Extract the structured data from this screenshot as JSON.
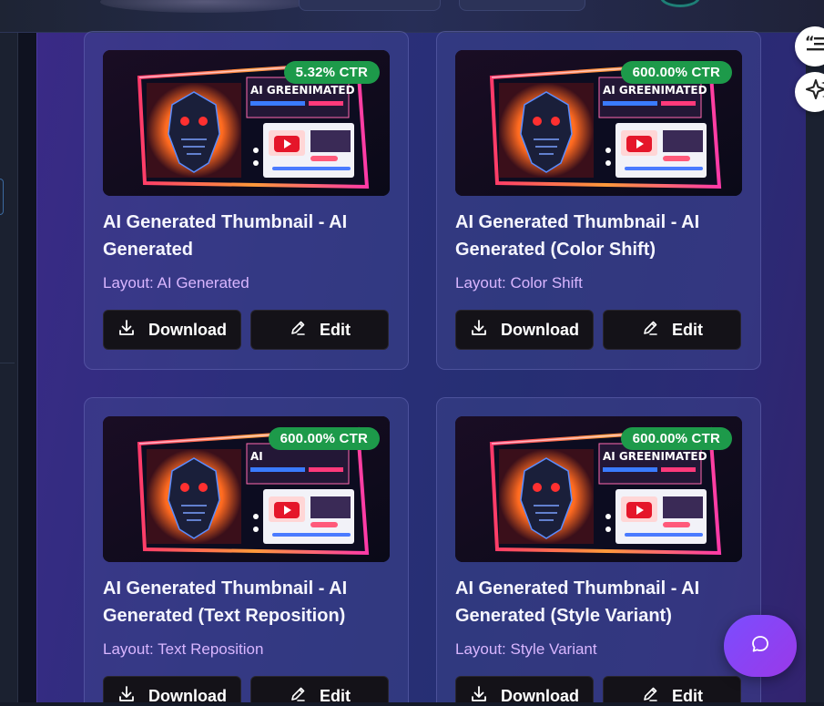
{
  "cards": [
    {
      "title": "AI Generated Thumbnail - AI Generated",
      "layout": "Layout: AI Generated",
      "ctr": "5.32% CTR",
      "thumb_text": "AI GREENIMATED"
    },
    {
      "title": "AI Generated Thumbnail - AI Generated (Color Shift)",
      "layout": "Layout: Color Shift",
      "ctr": "600.00% CTR",
      "thumb_text": "AI GREENIMATED"
    },
    {
      "title": "AI Generated Thumbnail - AI Generated (Text Reposition)",
      "layout": "Layout: Text Reposition",
      "ctr": "600.00% CTR",
      "thumb_text": "AI"
    },
    {
      "title": "AI Generated Thumbnail - AI Generated (Style Variant)",
      "layout": "Layout: Style Variant",
      "ctr": "600.00% CTR",
      "thumb_text": "AI GREENIMATED"
    }
  ],
  "buttons": {
    "download": "Download",
    "edit": "Edit"
  },
  "icons": {
    "download": "download-icon",
    "edit": "pencil-icon",
    "quote_tool": "quote-list-icon",
    "sparkle_tool": "sparkle-icon",
    "chat": "chat-bubble-icon"
  },
  "colors": {
    "ctr_badge": "#1d9a4a",
    "layout_text": "#d9b6ff",
    "button_bg": "#141218",
    "chat_button": "#8a44f0"
  }
}
